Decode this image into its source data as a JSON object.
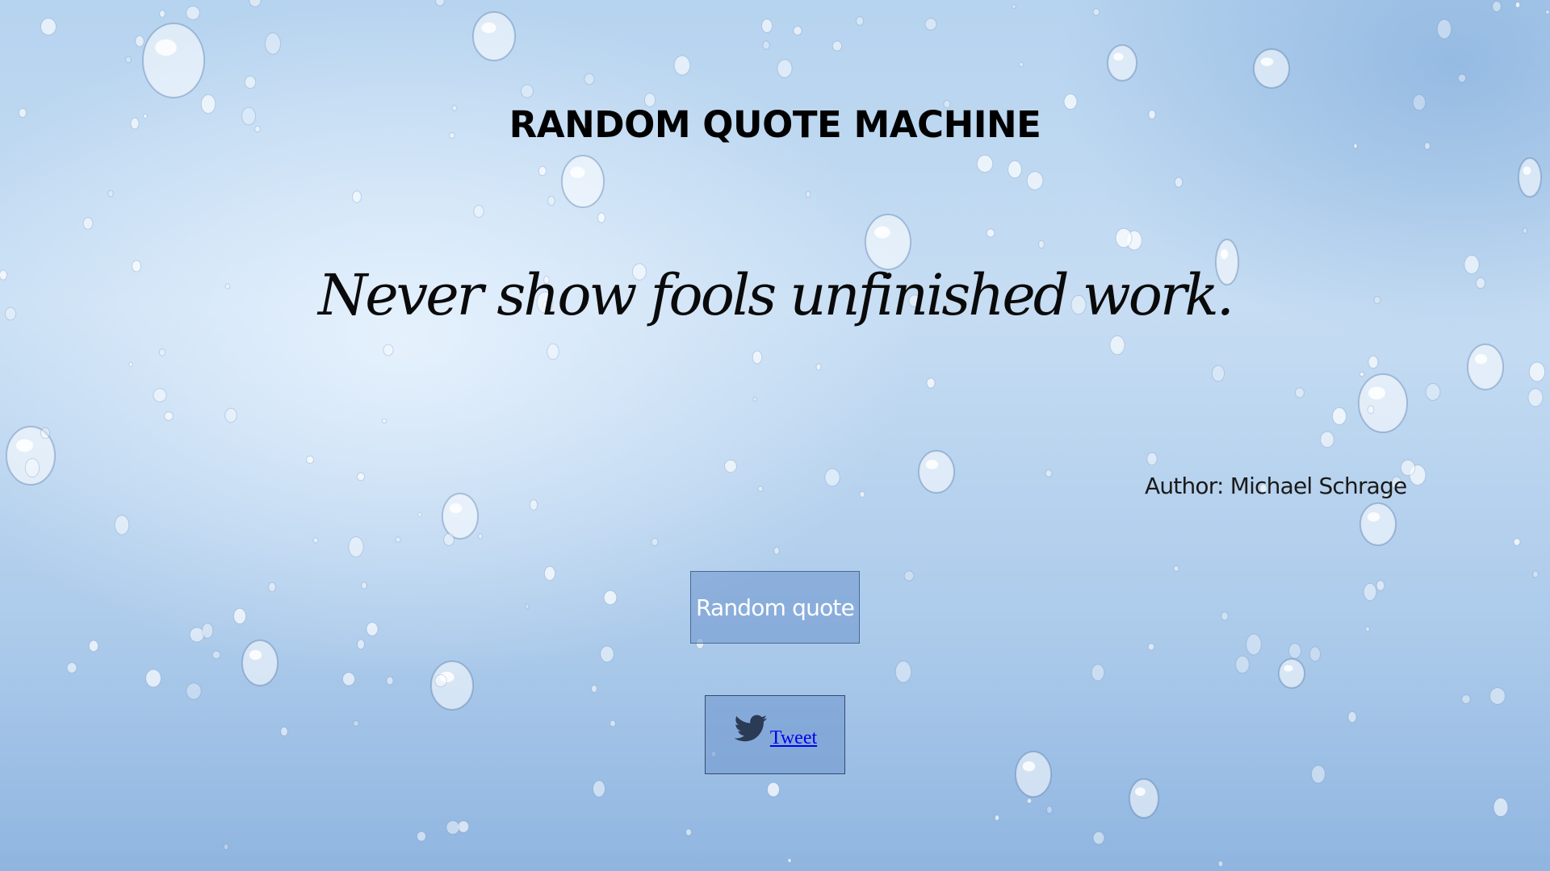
{
  "header": {
    "title": "RANDOM QUOTE MACHINE"
  },
  "quote": {
    "text": "Never show fools unfinished work.",
    "author": "Author: Michael Schrage"
  },
  "actions": {
    "random_label": "Random quote",
    "tweet_label": "Tweet",
    "tweet_icon": "twitter-bird-icon"
  },
  "colors": {
    "background": "#b6d3ef",
    "button_fill": "#7a9fd4",
    "link": "#0000ee",
    "twitter_icon": "#2b3a55"
  }
}
